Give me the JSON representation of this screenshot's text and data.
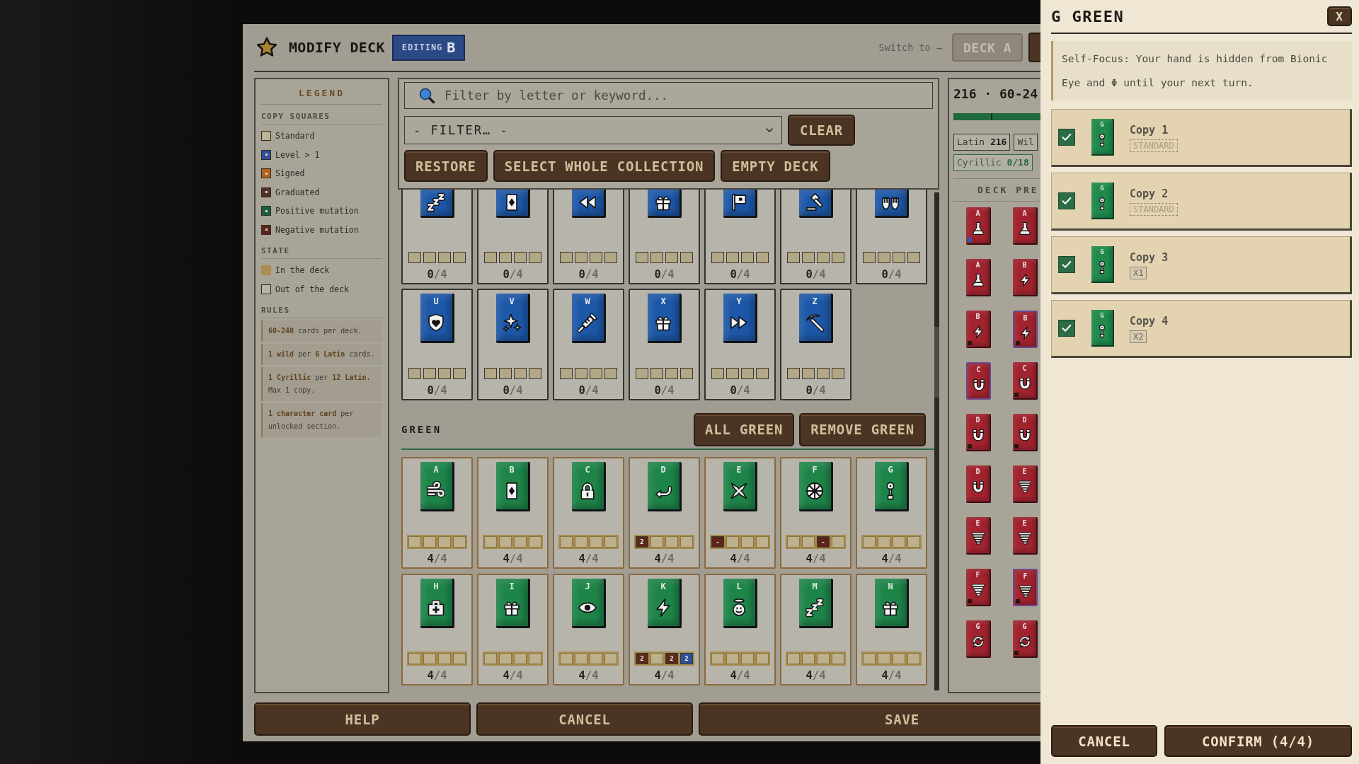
{
  "header": {
    "title": "MODIFY DECK",
    "editing": {
      "label": "EDITING",
      "deck": "B"
    },
    "switch_label": "Switch to →",
    "deck_buttons": [
      {
        "label": "DECK A",
        "selected": false
      },
      {
        "selected": true
      }
    ]
  },
  "legend": {
    "title": "LEGEND",
    "groups": [
      {
        "heading": "COPY SQUARES",
        "items": [
          {
            "kind": "standard",
            "label": "Standard"
          },
          {
            "kind": "level",
            "label": "Level > 1"
          },
          {
            "kind": "signed",
            "label": "Signed"
          },
          {
            "kind": "graduated",
            "label": "Graduated"
          },
          {
            "kind": "positive",
            "label": "Positive mutation"
          },
          {
            "kind": "negative",
            "label": "Negative mutation"
          }
        ]
      },
      {
        "heading": "STATE",
        "items": [
          {
            "kind": "in-deck",
            "label": "In the deck"
          },
          {
            "kind": "out-deck",
            "label": "Out of the deck"
          }
        ]
      }
    ],
    "rules_heading": "RULES",
    "rules": [
      "**60-240** cards per deck.",
      "**1 wild** per **6 Latin** cards.",
      "**1 Cyrillic** per **12 Latin**. Max 1 copy.",
      "**1 character card** per unlocked section."
    ]
  },
  "filters": {
    "search": {
      "placeholder": "Filter by letter or keyword..."
    },
    "select": {
      "value": "- FILTER… -"
    },
    "clear_button": "CLEAR",
    "actions": [
      "RESTORE",
      "SELECT WHOLE COLLECTION",
      "EMPTY DECK"
    ]
  },
  "sections": [
    {
      "color": "#1d58a8",
      "cards": [
        {
          "kind": "sleep",
          "in_deck": false,
          "slots": [
            {
              "kind": "standard"
            },
            {
              "kind": "standard"
            },
            {
              "kind": "standard"
            },
            {
              "kind": "standard"
            }
          ],
          "count": "**0**/4"
        },
        {
          "kind": "letter-card",
          "in_deck": false,
          "slots": [
            {
              "kind": "standard"
            },
            {
              "kind": "standard"
            },
            {
              "kind": "standard"
            },
            {
              "kind": "standard"
            }
          ],
          "count": "**0**/4"
        },
        {
          "kind": "rewind",
          "in_deck": false,
          "slots": [
            {
              "kind": "standard"
            },
            {
              "kind": "standard"
            },
            {
              "kind": "standard"
            },
            {
              "kind": "standard"
            }
          ],
          "count": "**0**/4"
        },
        {
          "kind": "gift",
          "in_deck": false,
          "slots": [
            {
              "kind": "standard"
            },
            {
              "kind": "standard"
            },
            {
              "kind": "standard"
            },
            {
              "kind": "standard"
            }
          ],
          "count": "**0**/4"
        },
        {
          "kind": "flag",
          "in_deck": false,
          "slots": [
            {
              "kind": "standard"
            },
            {
              "kind": "standard"
            },
            {
              "kind": "standard"
            },
            {
              "kind": "standard"
            }
          ],
          "count": "**0**/4"
        },
        {
          "kind": "gavel",
          "in_deck": false,
          "slots": [
            {
              "kind": "standard"
            },
            {
              "kind": "standard"
            },
            {
              "kind": "standard"
            },
            {
              "kind": "standard"
            }
          ],
          "count": "**0**/4"
        },
        {
          "kind": "gloves",
          "in_deck": false,
          "slots": [
            {
              "kind": "standard"
            },
            {
              "kind": "standard"
            },
            {
              "kind": "standard"
            },
            {
              "kind": "standard"
            }
          ],
          "count": "**0**/4"
        },
        {
          "letter": "U",
          "kind": "shield-heart",
          "in_deck": false,
          "slots": [
            {
              "kind": "standard"
            },
            {
              "kind": "standard"
            },
            {
              "kind": "standard"
            },
            {
              "kind": "standard"
            }
          ],
          "count": "**0**/4"
        },
        {
          "letter": "V",
          "kind": "sparkle",
          "in_deck": false,
          "slots": [
            {
              "kind": "standard"
            },
            {
              "kind": "standard"
            },
            {
              "kind": "standard"
            },
            {
              "kind": "standard"
            }
          ],
          "count": "**0**/4"
        },
        {
          "letter": "W",
          "kind": "syringe",
          "in_deck": false,
          "slots": [
            {
              "kind": "standard"
            },
            {
              "kind": "standard"
            },
            {
              "kind": "standard"
            },
            {
              "kind": "standard"
            }
          ],
          "count": "**0**/4"
        },
        {
          "letter": "X",
          "kind": "gift",
          "in_deck": false,
          "slots": [
            {
              "kind": "standard"
            },
            {
              "kind": "standard"
            },
            {
              "kind": "standard"
            },
            {
              "kind": "standard"
            }
          ],
          "count": "**0**/4"
        },
        {
          "letter": "Y",
          "kind": "fast-forward",
          "in_deck": false,
          "slots": [
            {
              "kind": "standard"
            },
            {
              "kind": "standard"
            },
            {
              "kind": "standard"
            },
            {
              "kind": "standard"
            }
          ],
          "count": "**0**/4"
        },
        {
          "letter": "Z",
          "kind": "pickaxe",
          "in_deck": false,
          "slots": [
            {
              "kind": "standard"
            },
            {
              "kind": "standard"
            },
            {
              "kind": "standard"
            },
            {
              "kind": "standard"
            }
          ],
          "count": "**0**/4"
        }
      ]
    },
    {
      "title": "GREEN",
      "color": "#1e8549",
      "buttons": [
        "ALL GREEN",
        "REMOVE GREEN"
      ],
      "cards": [
        {
          "letter": "A",
          "kind": "wind",
          "in_deck": true,
          "slots": [
            {
              "kind": "standard"
            },
            {
              "kind": "standard"
            },
            {
              "kind": "standard"
            },
            {
              "kind": "standard"
            }
          ],
          "count": "**4**/4"
        },
        {
          "letter": "B",
          "kind": "letter-card",
          "in_deck": true,
          "slots": [
            {
              "kind": "standard"
            },
            {
              "kind": "standard"
            },
            {
              "kind": "standard"
            },
            {
              "kind": "standard"
            }
          ],
          "count": "**4**/4"
        },
        {
          "letter": "C",
          "kind": "padlock",
          "in_deck": true,
          "slots": [
            {
              "kind": "standard"
            },
            {
              "kind": "standard"
            },
            {
              "kind": "standard"
            },
            {
              "kind": "standard"
            }
          ],
          "count": "**4**/4"
        },
        {
          "letter": "D",
          "kind": "return-arrow",
          "in_deck": true,
          "slots": [
            {
              "kind": "graduated",
              "mark": "2"
            },
            {
              "kind": "standard"
            },
            {
              "kind": "standard"
            },
            {
              "kind": "standard"
            }
          ],
          "count": "**4**/4"
        },
        {
          "letter": "E",
          "kind": "cross-burst",
          "in_deck": true,
          "slots": [
            {
              "kind": "negative",
              "mark": "-"
            },
            {
              "kind": "standard"
            },
            {
              "kind": "standard"
            },
            {
              "kind": "standard"
            }
          ],
          "count": "**4**/4"
        },
        {
          "letter": "F",
          "kind": "wheel",
          "in_deck": true,
          "slots": [
            {
              "kind": "standard"
            },
            {
              "kind": "standard"
            },
            {
              "kind": "negative",
              "mark": "-"
            },
            {
              "kind": "standard"
            }
          ],
          "count": "**4**/4"
        },
        {
          "letter": "G",
          "kind": "joystick",
          "in_deck": true,
          "slots": [
            {
              "kind": "standard"
            },
            {
              "kind": "standard"
            },
            {
              "kind": "standard"
            },
            {
              "kind": "standard"
            }
          ],
          "count": "**4**/4"
        },
        {
          "letter": "H",
          "kind": "medkit",
          "in_deck": true,
          "slots": [
            {
              "kind": "standard"
            },
            {
              "kind": "standard"
            },
            {
              "kind": "standard"
            },
            {
              "kind": "standard"
            }
          ],
          "count": "**4**/4"
        },
        {
          "letter": "I",
          "kind": "gift",
          "in_deck": true,
          "slots": [
            {
              "kind": "standard"
            },
            {
              "kind": "standard"
            },
            {
              "kind": "standard"
            },
            {
              "kind": "standard"
            }
          ],
          "count": "**4**/4"
        },
        {
          "letter": "J",
          "kind": "eye",
          "in_deck": true,
          "slots": [
            {
              "kind": "standard"
            },
            {
              "kind": "standard"
            },
            {
              "kind": "standard"
            },
            {
              "kind": "standard"
            }
          ],
          "count": "**4**/4"
        },
        {
          "letter": "K",
          "kind": "lightning",
          "in_deck": true,
          "slots": [
            {
              "kind": "graduated",
              "mark": "2"
            },
            {
              "kind": "standard"
            },
            {
              "kind": "graduated",
              "mark": "2"
            },
            {
              "kind": "level",
              "mark": "2"
            }
          ],
          "count": "**4**/4"
        },
        {
          "letter": "L",
          "kind": "halo-face",
          "in_deck": true,
          "slots": [
            {
              "kind": "standard"
            },
            {
              "kind": "standard"
            },
            {
              "kind": "standard"
            },
            {
              "kind": "standard"
            }
          ],
          "count": "**4**/4"
        },
        {
          "letter": "M",
          "kind": "sleep",
          "in_deck": true,
          "slots": [
            {
              "kind": "standard"
            },
            {
              "kind": "standard"
            },
            {
              "kind": "standard"
            },
            {
              "kind": "standard"
            }
          ],
          "count": "**4**/4"
        },
        {
          "letter": "N",
          "kind": "gift",
          "in_deck": true,
          "slots": [
            {
              "kind": "standard"
            },
            {
              "kind": "standard"
            },
            {
              "kind": "standard"
            },
            {
              "kind": "standard"
            }
          ],
          "count": "**4**/4"
        }
      ]
    }
  ],
  "deck_preview": {
    "summary": "216 · 60-24",
    "meter": {
      "level": 1
    },
    "counts": [
      {
        "kind": "count",
        "label": "Latin **216**"
      },
      {
        "kind": "count",
        "label": "Wil"
      },
      {
        "kind": "limit",
        "label": "Cyrillic **0/18**"
      }
    ],
    "heading": "DECK PRE",
    "cards": [
      {
        "letter": "A",
        "kind": "flask",
        "outlined": false,
        "corner_mark": {
          "kind": "level"
        }
      },
      {
        "letter": "A",
        "kind": "flask",
        "outlined": false
      },
      {
        "letter": "A",
        "kind": "flask",
        "outlined": false
      },
      {
        "letter": "B",
        "kind": "lightning",
        "outlined": false
      },
      {
        "letter": "B",
        "kind": "lightning",
        "outlined": false,
        "corner_mark": {
          "kind": "graduated"
        }
      },
      {
        "letter": "B",
        "kind": "lightning",
        "outlined": true,
        "corner_mark": {
          "kind": "graduated"
        }
      },
      {
        "letter": "C",
        "kind": "magnet",
        "outlined": true
      },
      {
        "letter": "C",
        "kind": "magnet",
        "outlined": false,
        "corner_mark": {
          "kind": "graduated"
        }
      },
      {
        "letter": "D",
        "kind": "magnet",
        "outlined": false,
        "corner_mark": {
          "kind": "graduated"
        }
      },
      {
        "letter": "D",
        "kind": "magnet",
        "outlined": false,
        "corner_mark": {
          "kind": "graduated"
        }
      },
      {
        "letter": "D",
        "kind": "magnet",
        "outlined": false
      },
      {
        "letter": "E",
        "kind": "tornado",
        "outlined": false
      },
      {
        "letter": "E",
        "kind": "tornado",
        "outlined": false
      },
      {
        "letter": "E",
        "kind": "tornado",
        "outlined": false
      },
      {
        "letter": "F",
        "kind": "tornado",
        "outlined": false,
        "corner_mark": {
          "kind": "graduated"
        }
      },
      {
        "letter": "F",
        "kind": "tornado",
        "outlined": true,
        "corner_mark": {
          "kind": "graduated"
        }
      },
      {
        "letter": "G",
        "kind": "recycle",
        "outlined": false
      },
      {
        "letter": "G",
        "kind": "recycle",
        "outlined": false,
        "corner_mark": {
          "kind": "graduated"
        }
      }
    ]
  },
  "footer": {
    "buttons": [
      "HELP",
      "CANCEL",
      "SAVE"
    ]
  },
  "detail": {
    "title": "G GREEN",
    "close": "X",
    "description": "Self-Focus: Your hand is hidden from Bionic Eye and Φ until your next turn.",
    "copies": [
      {
        "label": "Copy 1",
        "checked": true,
        "letter": "G",
        "kind": "joystick",
        "tag": {
          "kind": "standard",
          "text": "STANDARD"
        }
      },
      {
        "label": "Copy 2",
        "checked": true,
        "letter": "G",
        "kind": "joystick",
        "tag": {
          "kind": "standard",
          "text": "STANDARD"
        }
      },
      {
        "label": "Copy 3",
        "checked": true,
        "letter": "G",
        "kind": "joystick",
        "tag": {
          "kind": "multiplier",
          "text": "X1"
        }
      },
      {
        "label": "Copy 4",
        "checked": true,
        "letter": "G",
        "kind": "joystick",
        "tag": {
          "kind": "multiplier",
          "text": "X2"
        }
      }
    ],
    "buttons": [
      "CANCEL",
      "CONFIRM (4/4)"
    ]
  }
}
